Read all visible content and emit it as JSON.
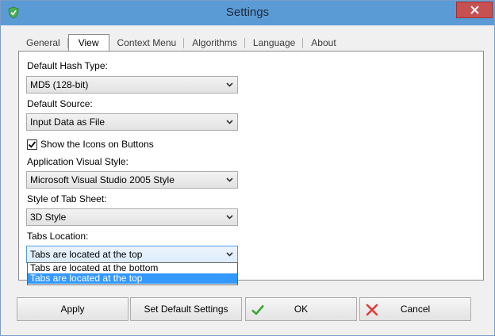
{
  "window": {
    "title": "Settings"
  },
  "tabs": [
    {
      "label": "General",
      "active": false
    },
    {
      "label": "View",
      "active": true
    },
    {
      "label": "Context Menu",
      "active": false
    },
    {
      "label": "Algorithms",
      "active": false
    },
    {
      "label": "Language",
      "active": false
    },
    {
      "label": "About",
      "active": false
    }
  ],
  "view": {
    "hash_type": {
      "label": "Default Hash Type:",
      "value": "MD5 (128-bit)"
    },
    "source": {
      "label": "Default Source:",
      "value": "Input Data as File"
    },
    "show_icons": {
      "label": "Show the Icons on Buttons",
      "checked": true
    },
    "visual_style": {
      "label": "Application Visual Style:",
      "value": "Microsoft Visual Studio 2005 Style"
    },
    "tab_style": {
      "label": "Style of Tab Sheet:",
      "value": "3D Style"
    },
    "tabs_location": {
      "label": "Tabs Location:",
      "value": "Tabs are located at the top",
      "options": [
        "Tabs are located at the bottom",
        "Tabs are located at the top"
      ],
      "highlighted": "Tabs are located at the top"
    }
  },
  "buttons": {
    "apply": "Apply",
    "default": "Set Default Settings",
    "ok": "OK",
    "cancel": "Cancel"
  },
  "colors": {
    "titlebar": "#5b9bd5",
    "close": "#c75050",
    "selection": "#3399ff",
    "ok_icon": "#3fa535",
    "cancel_icon": "#e03a3a"
  },
  "icons": {
    "app": "shield-check-icon",
    "close": "close-icon",
    "ok": "check-icon",
    "cancel": "x-icon",
    "combo": "chevron-down-icon"
  }
}
